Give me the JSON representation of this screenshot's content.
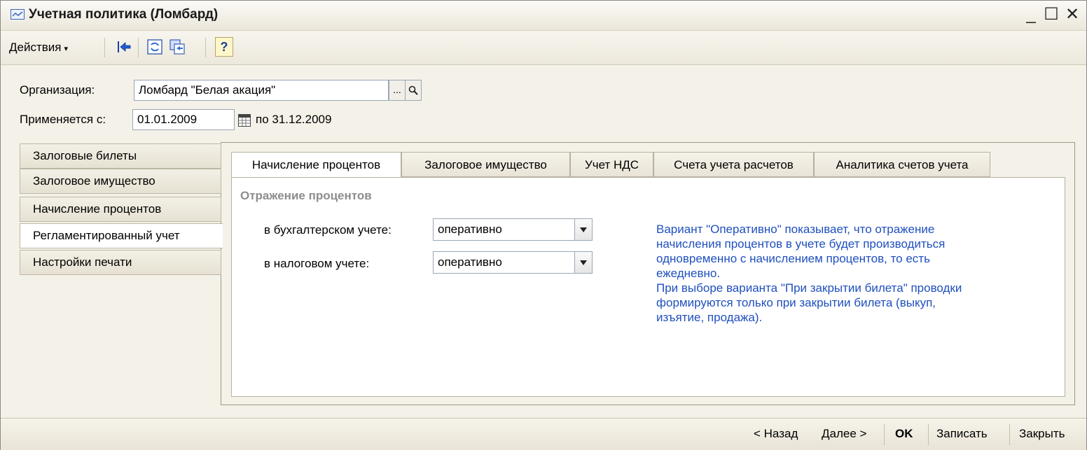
{
  "window": {
    "title": "Учетная политика (Ломбард)",
    "controls": {
      "minimize": "_",
      "maximize": "☐",
      "close": "✕"
    }
  },
  "toolbar": {
    "actions_label": "Действия",
    "actions_caret": "▾",
    "help_label": "?",
    "icons": [
      "back-arrow-icon",
      "refresh-icon",
      "copy-icon",
      "help-icon"
    ]
  },
  "form": {
    "organization_label": "Организация:",
    "organization_value": "Ломбард \"Белая акация\"",
    "select_btn": "...",
    "search_btn": "🔍",
    "applies_label": "Применяется с:",
    "applies_from": "01.01.2009",
    "applies_to_label": "по 31.12.2009"
  },
  "left_tabs": {
    "items": [
      {
        "label": "Залоговые билеты"
      },
      {
        "label": "Залоговое имущество"
      },
      {
        "label": "Начисление процентов"
      },
      {
        "label": "Регламентированный учет"
      },
      {
        "label": "Настройки печати"
      }
    ],
    "active_index": 3
  },
  "top_tabs": {
    "items": [
      {
        "label": "Начисление процентов"
      },
      {
        "label": "Залоговое имущество"
      },
      {
        "label": "Учет НДС"
      },
      {
        "label": "Счета учета расчетов"
      },
      {
        "label": "Аналитика счетов учета"
      }
    ],
    "active_index": 0
  },
  "interest_reflection": {
    "section_title": "Отражение процентов",
    "accounting_label": "в бухгалтерском учете:",
    "accounting_value": "оперативно",
    "tax_label": "в налоговом учете:",
    "tax_value": "оперативно",
    "hint_lines": [
      "Вариант \"Оперативно\" показывает, что отражение",
      "начисления процентов в учете будет производиться",
      "одновременно с начислением процентов, то есть",
      "ежедневно.",
      "При выборе варианта \"При закрытии билета\" проводки",
      "формируются только при закрытии билета (выкуп,",
      "изъятие, продажа)."
    ]
  },
  "bottom": {
    "back": "< Назад",
    "next": "Далее >",
    "ok": "OK",
    "save": "Записать",
    "close": "Закрыть"
  },
  "colors": {
    "hint_text": "#1f4fbf",
    "section_title": "#8d8d8d",
    "window_bg": "#f4f1e8"
  }
}
